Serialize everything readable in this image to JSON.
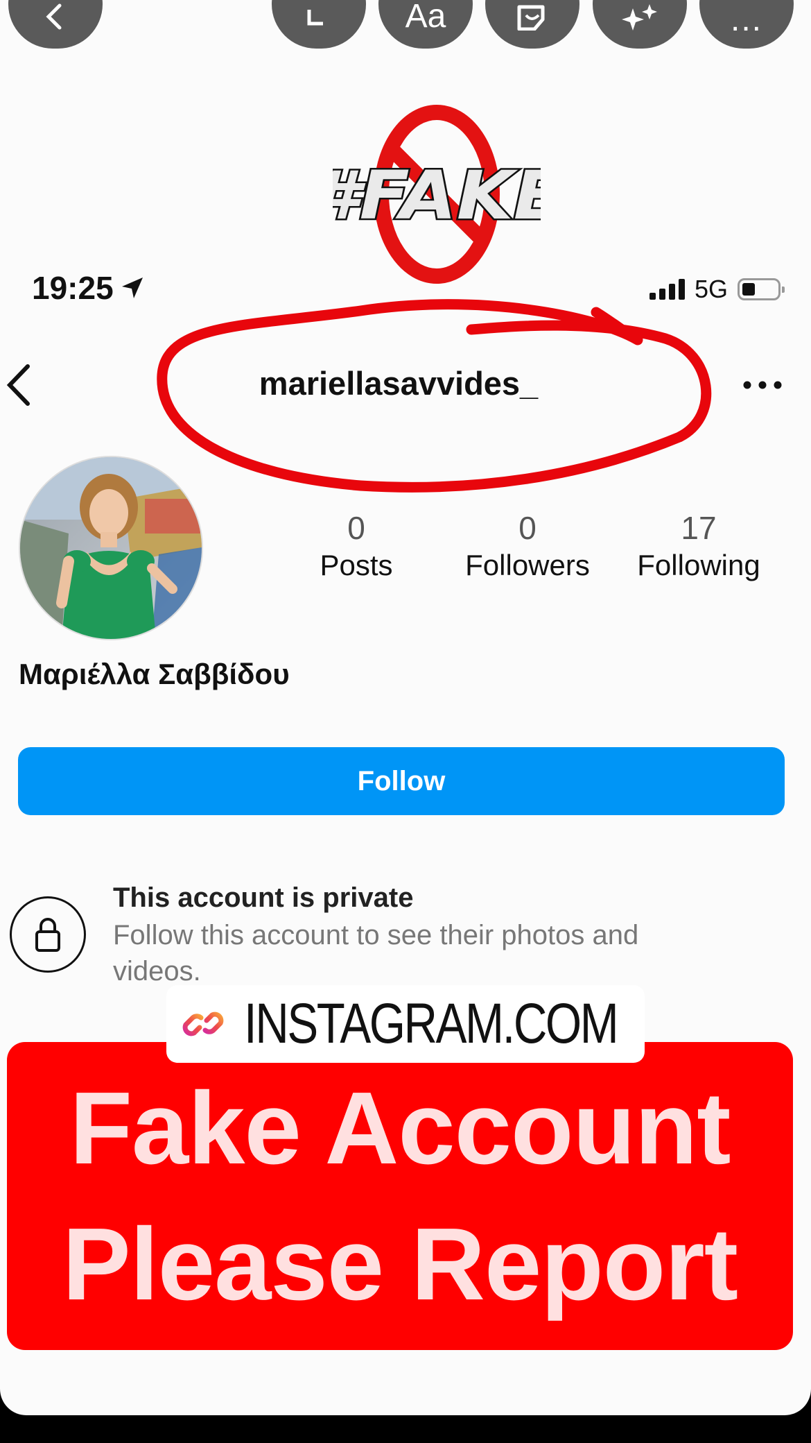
{
  "editor_toolbar": {
    "buttons": [
      {
        "name": "back",
        "label": ""
      },
      {
        "name": "resize",
        "label": ""
      },
      {
        "name": "text",
        "label": "Aa"
      },
      {
        "name": "sticker",
        "label": ""
      },
      {
        "name": "effects",
        "label": ""
      },
      {
        "name": "more",
        "label": "..."
      }
    ]
  },
  "stamp": {
    "text": "#FAKE"
  },
  "status_bar": {
    "time": "19:25",
    "network": "5G"
  },
  "profile": {
    "username": "mariellasavvides_",
    "display_name": "Μαριέλλα Σαββίδου",
    "stats": [
      {
        "value": "0",
        "label": "Posts"
      },
      {
        "value": "0",
        "label": "Followers"
      },
      {
        "value": "17",
        "label": "Following"
      }
    ],
    "follow_label": "Follow",
    "private_title": "This account is private",
    "private_desc": "Follow this account to see their photos and videos."
  },
  "link_sticker": {
    "label": "INSTAGRAM.COM"
  },
  "warning": {
    "line1": "Fake Account",
    "line2": "Please Report"
  },
  "colors": {
    "follow": "#0095f6",
    "warning": "#ff0000",
    "scribble": "#e8060c"
  }
}
